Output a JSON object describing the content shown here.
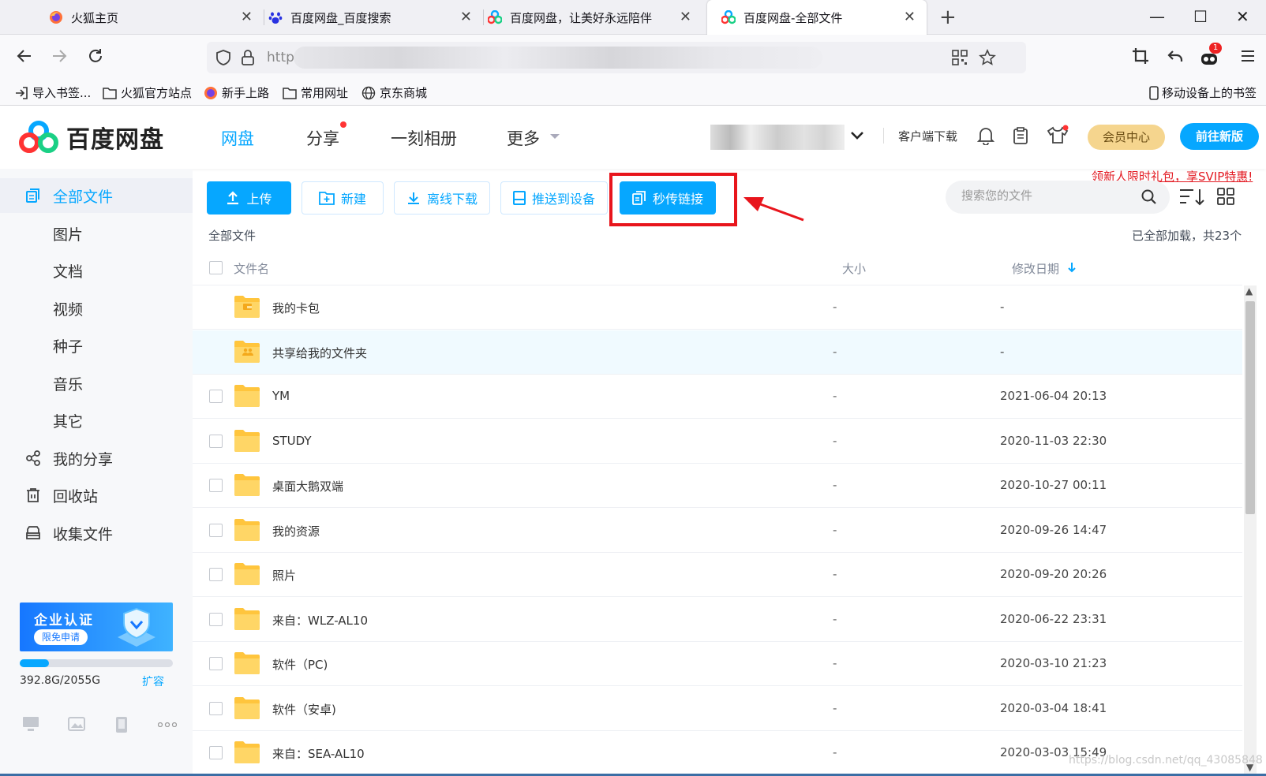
{
  "browser": {
    "tabs": [
      {
        "label": "火狐主页",
        "icon": "firefox-icon"
      },
      {
        "label": "百度网盘_百度搜索",
        "icon": "baidu-paw-icon"
      },
      {
        "label": "百度网盘，让美好永远陪伴",
        "icon": "baidu-netdisk-icon"
      },
      {
        "label": "百度网盘-全部文件",
        "icon": "baidu-netdisk-icon",
        "active": true
      }
    ],
    "url_prefix": "http",
    "bookmarks": [
      "导入书签...",
      "火狐官方站点",
      "新手上路",
      "常用网址",
      "京东商城"
    ],
    "mobile_bookmarks": "移动设备上的书签",
    "extension_badge": "1"
  },
  "app": {
    "logo_text": "百度网盘",
    "nav": [
      "网盘",
      "分享",
      "一刻相册",
      "更多"
    ],
    "client_download": "客户端下载",
    "vip_center": "会员中心",
    "new_version": "前往新版",
    "promo": "领新人限时礼包，享SVIP特惠!"
  },
  "sidebar": {
    "items": [
      {
        "label": "全部文件",
        "icon": "all-files-icon",
        "active": true
      },
      {
        "label": "图片"
      },
      {
        "label": "文档"
      },
      {
        "label": "视频"
      },
      {
        "label": "种子"
      },
      {
        "label": "音乐"
      },
      {
        "label": "其它"
      },
      {
        "label": "我的分享",
        "icon": "share-icon"
      },
      {
        "label": "回收站",
        "icon": "trash-icon"
      },
      {
        "label": "收集文件",
        "icon": "collect-icon"
      }
    ],
    "enterprise_title": "企业认证",
    "enterprise_sub": "限免申请",
    "quota_text": "392.8G/2055G",
    "quota_fraction": 0.191,
    "expand": "扩容"
  },
  "toolbar": {
    "upload": "上传",
    "new": "新建",
    "offline_download": "离线下载",
    "push_device": "推送到设备",
    "instant_link": "秒传链接",
    "search_placeholder": "搜索您的文件"
  },
  "list": {
    "breadcrumb": "全部文件",
    "load_status": "已全部加载，共23个",
    "col_name": "文件名",
    "col_size": "大小",
    "col_date": "修改日期",
    "rows": [
      {
        "name": "我的卡包",
        "size": "-",
        "date": "-",
        "type": "wallet"
      },
      {
        "name": "共享给我的文件夹",
        "size": "-",
        "date": "-",
        "type": "shared"
      },
      {
        "name": "YM",
        "size": "-",
        "date": "2021-06-04 20:13",
        "type": "folder"
      },
      {
        "name": "STUDY",
        "size": "-",
        "date": "2020-11-03 22:30",
        "type": "folder"
      },
      {
        "name": "桌面大鹅双端",
        "size": "-",
        "date": "2020-10-27 00:11",
        "type": "folder"
      },
      {
        "name": "我的资源",
        "size": "-",
        "date": "2020-09-26 14:47",
        "type": "folder"
      },
      {
        "name": "照片",
        "size": "-",
        "date": "2020-09-20 20:26",
        "type": "folder"
      },
      {
        "name": "来自：WLZ-AL10",
        "size": "-",
        "date": "2020-06-22 23:31",
        "type": "folder"
      },
      {
        "name": "软件（PC)",
        "size": "-",
        "date": "2020-03-10 21:23",
        "type": "folder"
      },
      {
        "name": "软件（安卓)",
        "size": "-",
        "date": "2020-03-04 18:41",
        "type": "folder"
      },
      {
        "name": "来自：SEA-AL10",
        "size": "-",
        "date": "2020-03-03 15:49",
        "type": "folder"
      }
    ]
  },
  "watermark": "https://blog.csdn.net/qq_43085848",
  "colors": {
    "accent": "#06a7ff",
    "highlight": "#e8151c",
    "folder": "#ffc53d"
  }
}
